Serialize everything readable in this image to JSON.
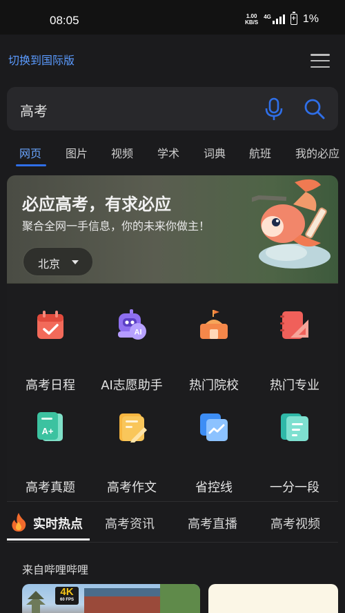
{
  "status": {
    "time": "08:05",
    "net_speed_value": "1.00",
    "net_speed_unit": "KB/S",
    "net_type": "4G",
    "battery": "1%"
  },
  "top": {
    "switch_label": "切换到国际版",
    "menu_icon": "hamburger-menu-icon"
  },
  "search": {
    "query": "高考",
    "mic_icon": "microphone-icon",
    "search_icon": "search-icon",
    "accent_color": "#2f6fe8"
  },
  "tabs": [
    "网页",
    "图片",
    "视频",
    "学术",
    "词典",
    "航班",
    "我的必应"
  ],
  "banner": {
    "title": "必应高考，有求必应",
    "subtitle": "聚合全网一手信息，你的未来你做主！",
    "city": "北京"
  },
  "grid": [
    {
      "label": "高考日程",
      "icon": "calendar-check-icon"
    },
    {
      "label": "AI志愿助手",
      "icon": "ai-robot-icon"
    },
    {
      "label": "热门院校",
      "icon": "school-building-icon"
    },
    {
      "label": "热门专业",
      "icon": "notebook-ruler-icon"
    },
    {
      "label": "高考真题",
      "icon": "exam-paper-icon"
    },
    {
      "label": "高考作文",
      "icon": "essay-pencil-icon"
    },
    {
      "label": "省控线",
      "icon": "trend-chart-icon"
    },
    {
      "label": "一分一段",
      "icon": "document-list-icon"
    }
  ],
  "feed_tabs": [
    "实时热点",
    "高考资讯",
    "高考直播",
    "高考视频"
  ],
  "feed": {
    "source_label": "来自哔哩哔哩",
    "badge_main": "4K",
    "badge_sub": "60 FPS"
  }
}
